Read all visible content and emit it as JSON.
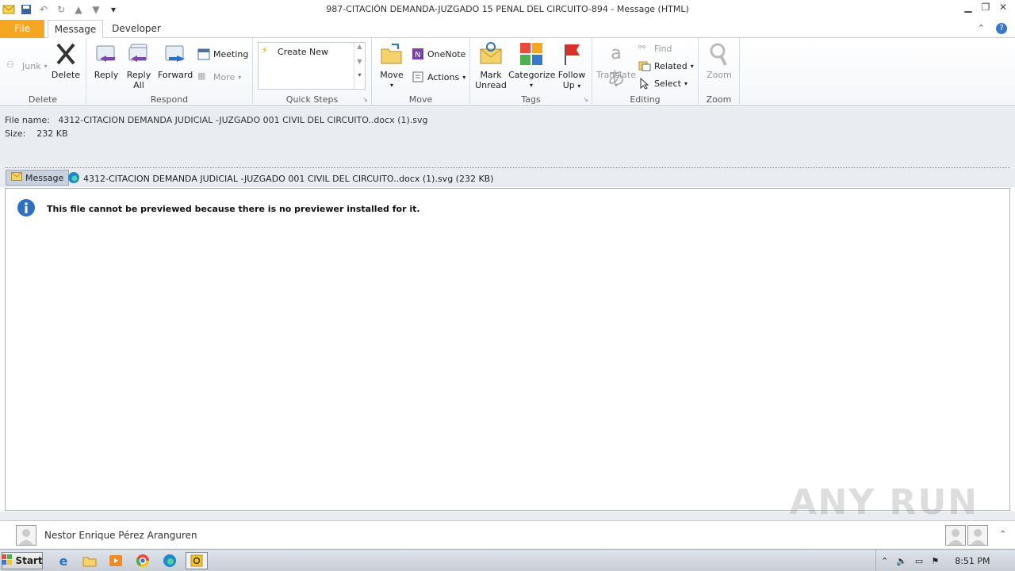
{
  "window": {
    "title": "987-CITACIÓN  DEMANDA-JUZGADO 15 PENAL DEL CIRCUITO-894 -  Message (HTML)"
  },
  "tabs": {
    "file": "File",
    "message": "Message",
    "developer": "Developer"
  },
  "ribbon": {
    "delete_group": {
      "label": "Delete",
      "junk": "Junk",
      "delete": "Delete"
    },
    "respond_group": {
      "label": "Respond",
      "reply": "Reply",
      "reply_all_1": "Reply",
      "reply_all_2": "All",
      "forward": "Forward",
      "meeting": "Meeting",
      "more": "More"
    },
    "quicksteps_group": {
      "label": "Quick Steps",
      "create_new": "Create New"
    },
    "move_group": {
      "label": "Move",
      "move": "Move",
      "onenote": "OneNote",
      "actions": "Actions"
    },
    "tags_group": {
      "label": "Tags",
      "mark_unread_1": "Mark",
      "mark_unread_2": "Unread",
      "categorize": "Categorize",
      "follow_up_1": "Follow",
      "follow_up_2": "Up"
    },
    "editing_group": {
      "label": "Editing",
      "translate": "Translate",
      "find": "Find",
      "related": "Related",
      "select": "Select"
    },
    "zoom_group": {
      "label": "Zoom",
      "zoom": "Zoom"
    }
  },
  "attachment": {
    "file_name_label": "File name:",
    "file_name": "4312-CITACION  DEMANDA JUDICIAL -JUZGADO 001 CIVIL DEL CIRCUITO..docx (1).svg",
    "size_label": "Size:",
    "size": "232 KB",
    "message_tab": "Message",
    "item_text": "4312-CITACION  DEMANDA JUDICIAL -JUZGADO 001 CIVIL DEL CIRCUITO..docx (1).svg (232 KB)"
  },
  "preview": {
    "message": "This file cannot be previewed because there is no previewer installed for it."
  },
  "people_pane": {
    "name": "Nestor Enrique Pérez Aranguren"
  },
  "watermark": "ANY RUN",
  "taskbar": {
    "start": "Start",
    "clock": "8:51 PM"
  },
  "colors": {
    "file_tab": "#f5a623",
    "ribbon_bg": "#f4f6f9",
    "info_bg": "#e9ecf1"
  }
}
